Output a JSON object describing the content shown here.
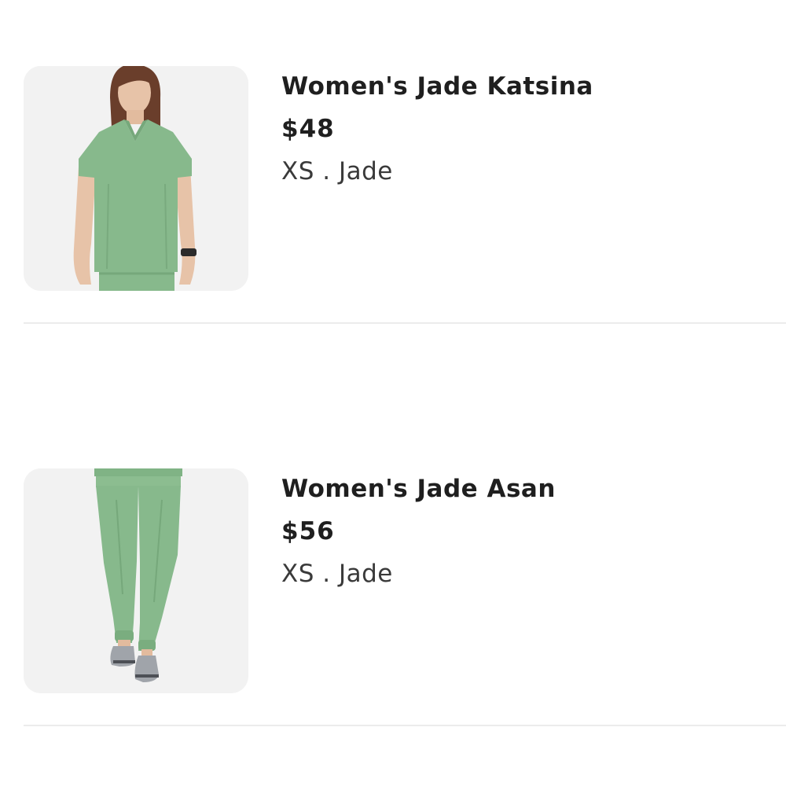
{
  "colors": {
    "jade": "#87b98c",
    "thumb_bg": "#f2f2f2",
    "divider": "#ececec"
  },
  "cart_items": [
    {
      "name": "Women's Jade Katsina",
      "price": "$48",
      "variant": "XS . Jade",
      "image_alt": "product-image-scrub-top"
    },
    {
      "name": "Women's Jade Asan",
      "price": "$56",
      "variant": "XS . Jade",
      "image_alt": "product-image-scrub-pants"
    }
  ]
}
